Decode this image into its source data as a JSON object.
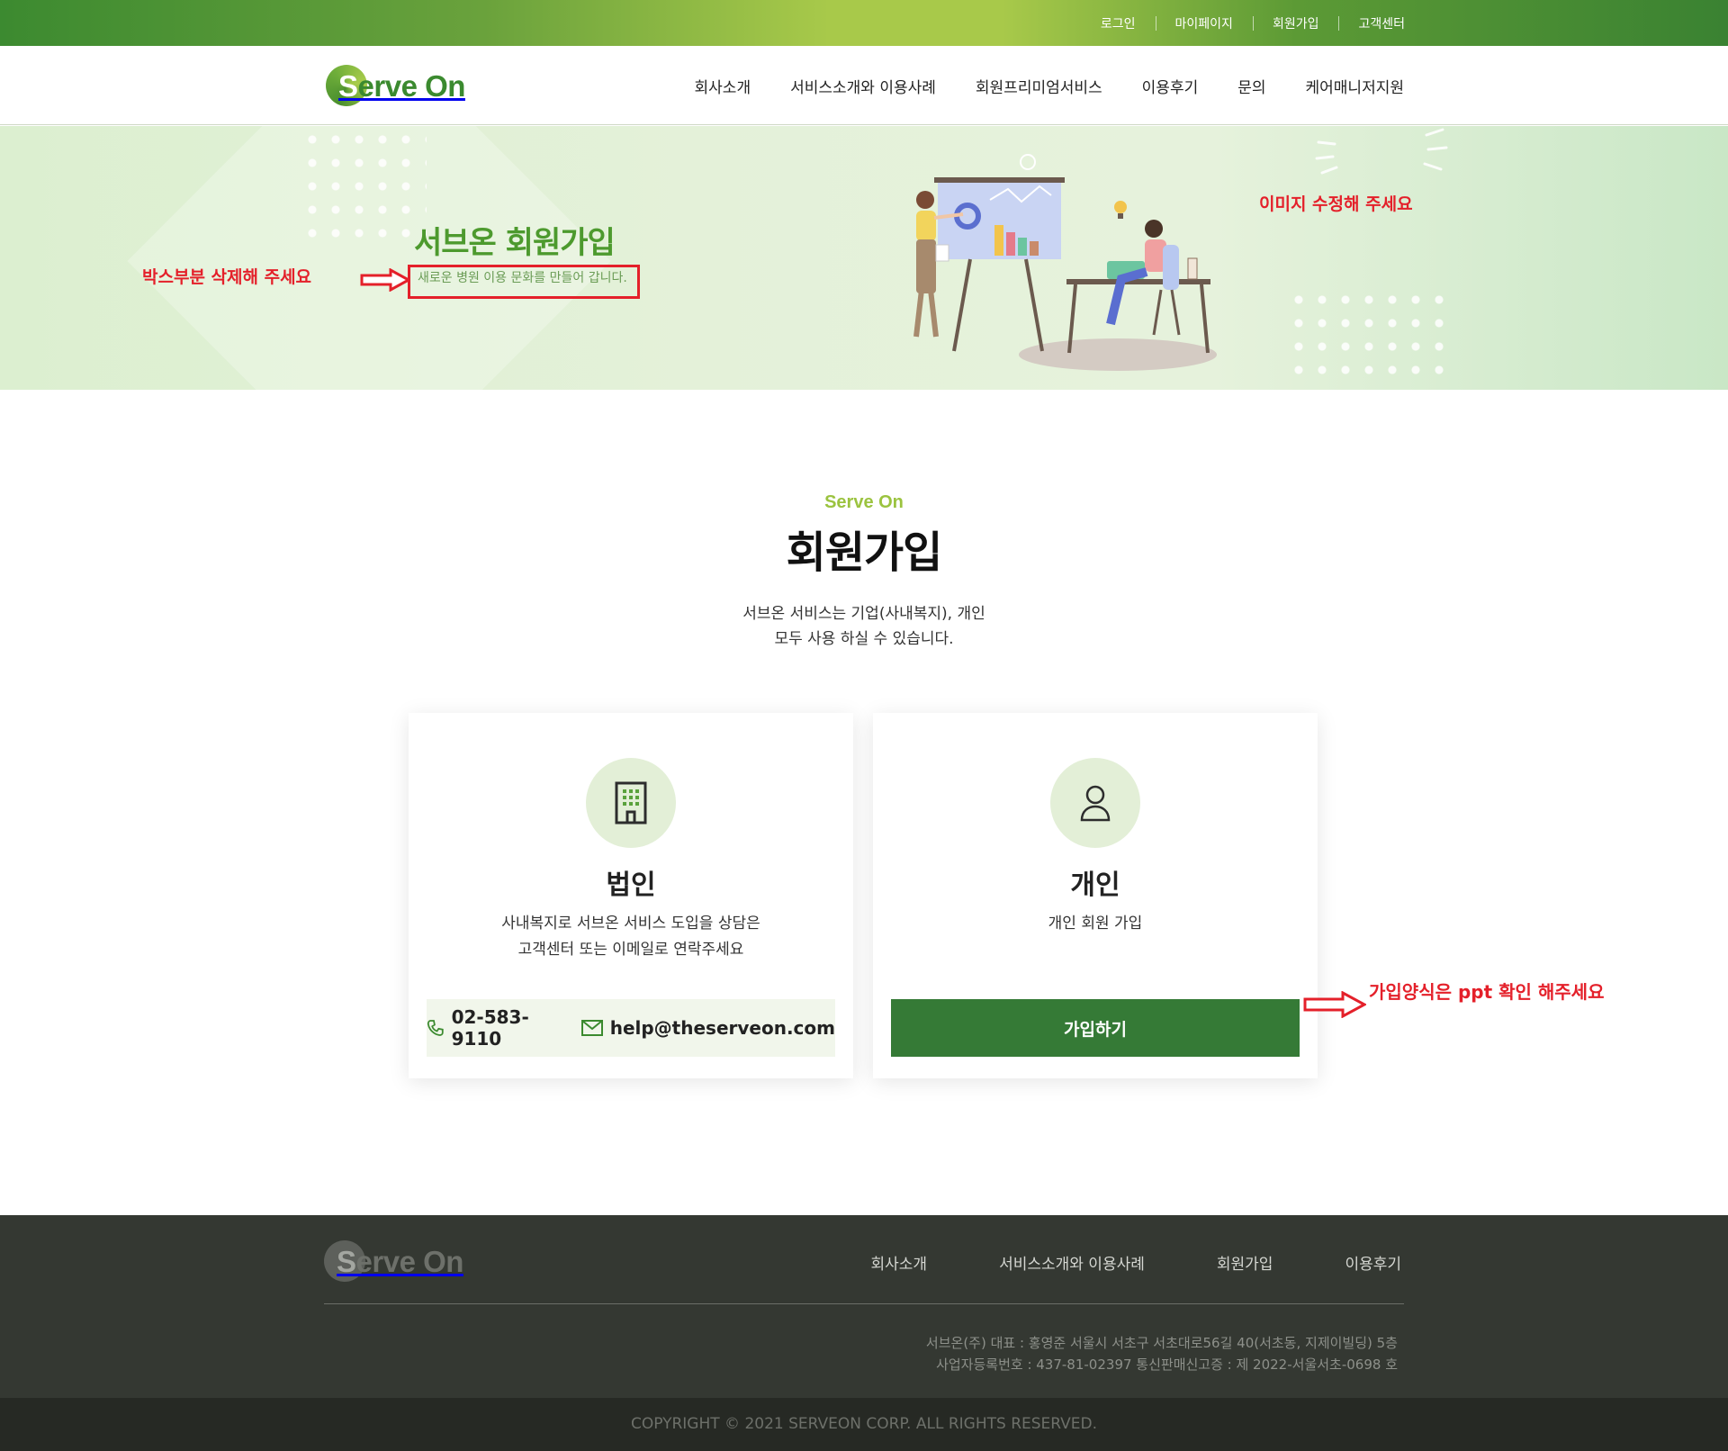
{
  "topbar": {
    "links": [
      "로그인",
      "마이페이지",
      "회원가입",
      "고객센터"
    ]
  },
  "header": {
    "logo_prefix": "S",
    "logo_rest": "erve On",
    "nav": [
      "회사소개",
      "서비스소개와 이용사례",
      "회원프리미엄서비스",
      "이용후기",
      "문의",
      "케어매니저지원"
    ]
  },
  "hero": {
    "title": "서브온 회원가입",
    "subtitle": "새로운 병원 이용 문화를 만들어 갑니다.",
    "annotation_left": "박스부분 삭제해 주세요",
    "annotation_right": "이미지 수정해 주세요"
  },
  "section": {
    "brand": "Serve On",
    "title": "회원가입",
    "desc_line1": "서브온 서비스는 기업(사내복지), 개인",
    "desc_line2": "모두 사용 하실 수 있습니다."
  },
  "cards": {
    "corporate": {
      "title": "법인",
      "desc_line1": "사내복지로 서브온 서비스 도입을 상담은",
      "desc_line2": "고객센터 또는 이메일로  연락주세요",
      "phone": "02-583-9110",
      "email": "help@theserveon.com"
    },
    "personal": {
      "title": "개인",
      "desc_line1": "개인 회원 가입",
      "button": "가입하기",
      "annotation": "가입양식은 ppt 확인 해주세요"
    }
  },
  "footer": {
    "logo_prefix": "S",
    "logo_rest": "erve On",
    "nav": [
      "회사소개",
      "서비스소개와 이용사례",
      "회원가입",
      "이용후기"
    ],
    "info_line1": "서브온(주) 대표 : 홍영준 서울시 서초구 서초대로56길 40(서초동, 지제이빌딩) 5층",
    "info_line2": "사업자등록번호 : 437-81-02397  통신판매신고증 : 제 2022-서울서초-0698 호",
    "copyright": "COPYRIGHT © 2021 SERVEON CORP. ALL RIGHTS RESERVED."
  },
  "colors": {
    "brand_green": "#3b8a2f",
    "light_green": "#9bc33f",
    "button_green": "#357a36",
    "annotation_red": "#e4202a",
    "footer_bg": "#343832"
  }
}
